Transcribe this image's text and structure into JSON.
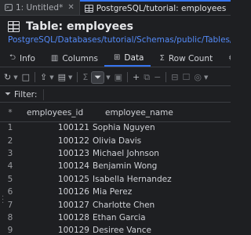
{
  "tabs": [
    {
      "label": "1: Untitled*",
      "active": false
    },
    {
      "label": "PostgreSQL/tutorial: employees",
      "active": true
    }
  ],
  "title": "Table: employees",
  "path": "PostgreSQL/Databases/tutorial/Schemas/public/Tables/employees",
  "view_tabs": [
    {
      "label": "Info",
      "icon": "info-icon"
    },
    {
      "label": "Columns",
      "icon": "columns-icon"
    },
    {
      "label": "Data",
      "icon": "grid-icon",
      "active": true
    },
    {
      "label": "Row Count",
      "icon": "sigma-icon"
    },
    {
      "label": "P",
      "icon": "properties-icon"
    }
  ],
  "filter": {
    "label": "Filter:",
    "value": ""
  },
  "grid": {
    "columns": [
      "*",
      "employees_id",
      "employee_name"
    ],
    "rows": [
      {
        "n": "1",
        "id": "100121",
        "name": "Sophia Nguyen"
      },
      {
        "n": "2",
        "id": "100122",
        "name": "Olivia Davis"
      },
      {
        "n": "3",
        "id": "100123",
        "name": "Michael Johnson"
      },
      {
        "n": "4",
        "id": "100124",
        "name": "Benjamin Wong"
      },
      {
        "n": "5",
        "id": "100125",
        "name": "Isabella Hernandez"
      },
      {
        "n": "6",
        "id": "100126",
        "name": "Mia Perez"
      },
      {
        "n": "7",
        "id": "100127",
        "name": "Charlotte Chen"
      },
      {
        "n": "8",
        "id": "100128",
        "name": "Ethan Garcia"
      },
      {
        "n": "9",
        "id": "100129",
        "name": "Desiree Vance"
      }
    ]
  },
  "colors": {
    "accent": "#3574f0",
    "link": "#548af7",
    "background": "#1e1f22"
  }
}
